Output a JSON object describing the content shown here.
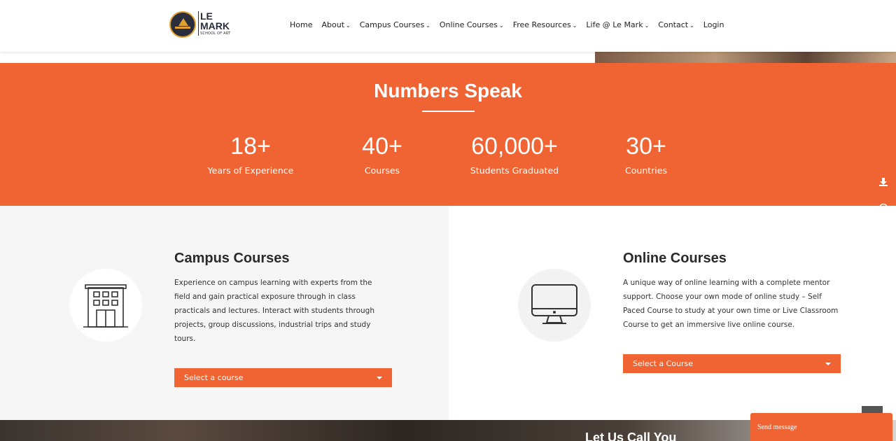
{
  "header": {
    "logo": {
      "line1": "LE",
      "line2": "MARK",
      "line3": "SCHOOL OF ART"
    },
    "nav": [
      {
        "label": "Home",
        "dropdown": false
      },
      {
        "label": "About",
        "dropdown": true
      },
      {
        "label": "Campus Courses",
        "dropdown": true
      },
      {
        "label": "Online Courses",
        "dropdown": true
      },
      {
        "label": "Free Resources",
        "dropdown": true
      },
      {
        "label": "Life @ Le Mark",
        "dropdown": true
      },
      {
        "label": "Contact",
        "dropdown": true
      },
      {
        "label": "Login",
        "dropdown": false
      }
    ]
  },
  "numbers": {
    "title": "Numbers Speak",
    "stats": [
      {
        "value": "18+",
        "label": "Years of Experience"
      },
      {
        "value": "40+",
        "label": "Courses"
      },
      {
        "value": "60,000+",
        "label": "Students Graduated"
      },
      {
        "value": "30+",
        "label": "Countries"
      }
    ]
  },
  "side_buttons": {
    "download_icon": "download-icon",
    "whatsapp_icon": "whatsapp-icon"
  },
  "campus": {
    "icon": "building-icon",
    "title": "Campus Courses",
    "description": "Experience on campus learning with experts from the field and gain practical exposure through in class practicals and lectures.  Interact with students through projects, group discussions, industrial trips and study tours.",
    "select_label": "Select a course"
  },
  "online": {
    "icon": "monitor-icon",
    "title": "Online Courses",
    "description": "A unique way of online learning with a complete mentor support. Choose your own mode of online study – Self Paced Course to study at your own time or Live Classroom Course to get an immersive live online course.",
    "select_label": "Select a Course"
  },
  "bottom": {
    "heading": "Let Us Call You",
    "chat_label": "Send message"
  },
  "colors": {
    "accent": "#f06434",
    "dark": "#2a2d3c",
    "panel": "#f6f6f6"
  }
}
